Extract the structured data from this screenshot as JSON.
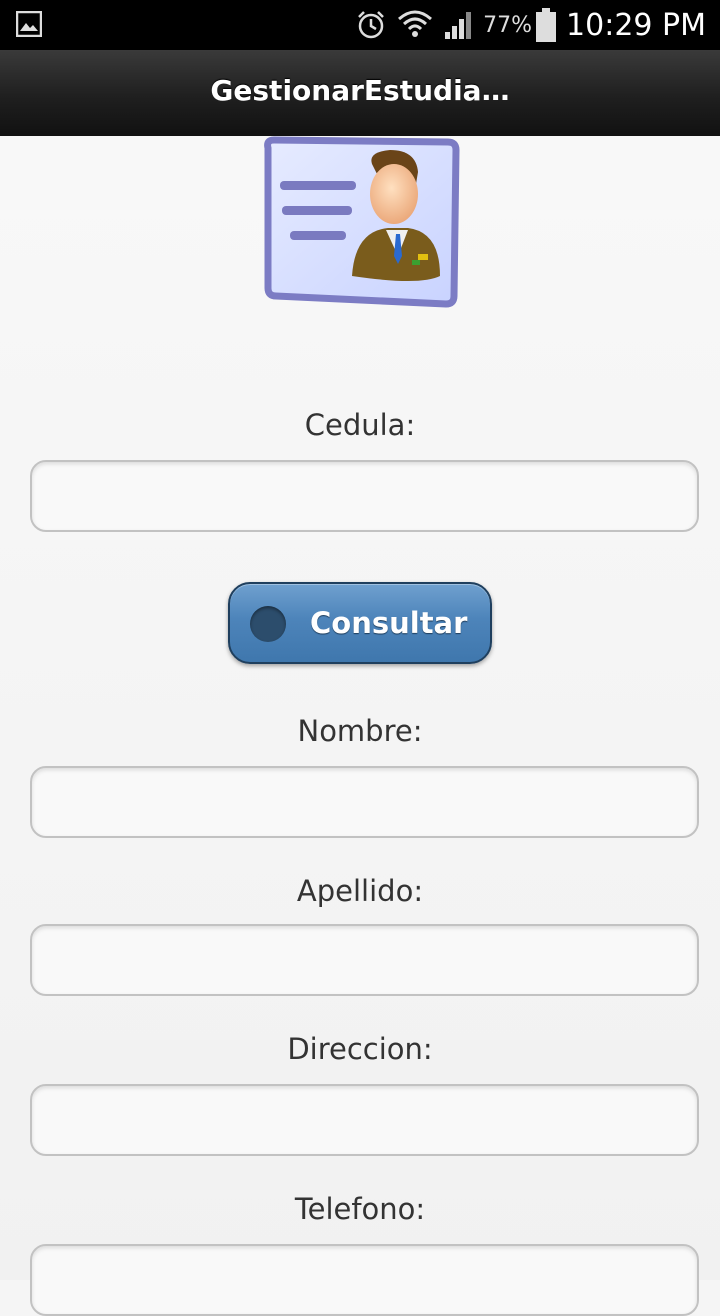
{
  "status_bar": {
    "battery_percent": "77%",
    "time": "10:29 PM",
    "icons": [
      "gallery-icon",
      "alarm-icon",
      "wifi-icon",
      "signal-icon",
      "battery-icon"
    ]
  },
  "header": {
    "title": "GestionarEstudia…"
  },
  "form": {
    "image_icon": "student-id-card-icon",
    "cedula_label": "Cedula:",
    "cedula_value": "",
    "consult_button_label": "Consultar",
    "nombre_label": "Nombre:",
    "nombre_value": "",
    "apellido_label": "Apellido:",
    "apellido_value": "",
    "direccion_label": "Direccion:",
    "direccion_value": "",
    "telefono_label": "Telefono:",
    "telefono_value": ""
  },
  "colors": {
    "header_bg": "#1f1f1f",
    "button_bg": "#4d84ba",
    "button_border": "#1f3f5e",
    "page_bg": "#f5f5f5"
  }
}
